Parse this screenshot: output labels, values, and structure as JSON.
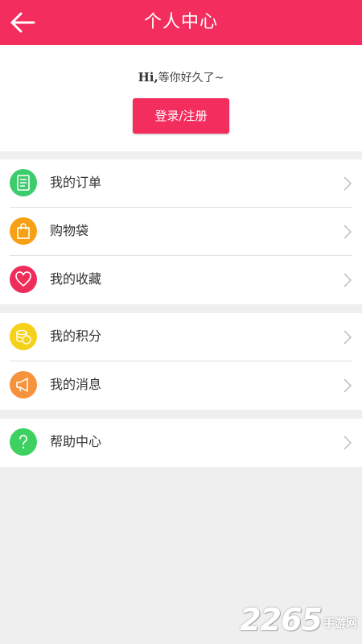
{
  "header": {
    "title": "个人中心"
  },
  "profile": {
    "greeting_hi": "Hi,",
    "greeting_text": "等你好久了~",
    "login_label": "登录/注册"
  },
  "groups": [
    {
      "items": [
        {
          "label": "我的订单",
          "icon": "order-list-icon",
          "color": "#3ccc6b"
        },
        {
          "label": "购物袋",
          "icon": "shopping-bag-icon",
          "color": "#f5a015"
        },
        {
          "label": "我的收藏",
          "icon": "heart-icon",
          "color": "#ef2d5b"
        }
      ]
    },
    {
      "items": [
        {
          "label": "我的积分",
          "icon": "coins-icon",
          "color": "#f5d219"
        },
        {
          "label": "我的消息",
          "icon": "megaphone-icon",
          "color": "#f7923c"
        }
      ]
    },
    {
      "items": [
        {
          "label": "帮助中心",
          "icon": "question-icon",
          "color": "#3cd160"
        }
      ]
    }
  ],
  "watermark": {
    "number": "2265",
    "text": "手游网"
  },
  "colors": {
    "brand": "#f42d5f",
    "background": "#efefef"
  }
}
